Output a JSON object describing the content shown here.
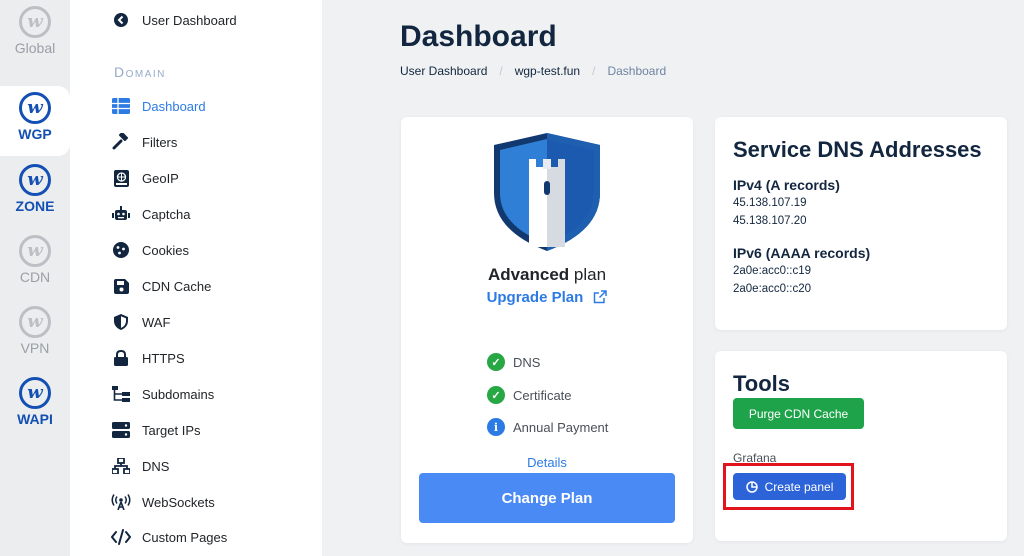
{
  "rail": [
    {
      "label": "Global",
      "logo": "w-logo"
    },
    {
      "label": "WGP",
      "logo": "w-logo"
    },
    {
      "label": "ZONE",
      "logo": "w-logo"
    },
    {
      "label": "CDN",
      "logo": "w-logo"
    },
    {
      "label": "VPN",
      "logo": "w-logo"
    },
    {
      "label": "WAPI",
      "logo": "w-logo"
    }
  ],
  "sidebar": {
    "back_label": "User Dashboard",
    "section_title": "Domain",
    "items": [
      {
        "label": "Dashboard",
        "icon": "table-icon"
      },
      {
        "label": "Filters",
        "icon": "gavel-icon"
      },
      {
        "label": "GeoIP",
        "icon": "atlas-icon"
      },
      {
        "label": "Captcha",
        "icon": "robot-icon"
      },
      {
        "label": "Cookies",
        "icon": "cookie-icon"
      },
      {
        "label": "CDN Cache",
        "icon": "save-icon"
      },
      {
        "label": "WAF",
        "icon": "shield-icon"
      },
      {
        "label": "HTTPS",
        "icon": "lock-icon"
      },
      {
        "label": "Subdomains",
        "icon": "sitemap-icon"
      },
      {
        "label": "Target IPs",
        "icon": "server-icon"
      },
      {
        "label": "DNS",
        "icon": "network-icon"
      },
      {
        "label": "WebSockets",
        "icon": "broadcast-icon"
      },
      {
        "label": "Custom Pages",
        "icon": "code-icon"
      }
    ]
  },
  "header": {
    "title": "Dashboard",
    "breadcrumb": [
      "User Dashboard",
      "wgp-test.fun",
      "Dashboard"
    ]
  },
  "plan": {
    "name_bold": "Advanced",
    "name_rest": " plan",
    "upgrade_label": "Upgrade Plan",
    "features": [
      {
        "label": "DNS",
        "status": "check"
      },
      {
        "label": "Certificate",
        "status": "check"
      },
      {
        "label": "Annual Payment",
        "status": "info"
      }
    ],
    "details_label": "Details",
    "change_label": "Change Plan"
  },
  "dns": {
    "title": "Service DNS Addresses",
    "ipv4_title": "IPv4 (A records)",
    "ipv4": [
      "45.138.107.19",
      "45.138.107.20"
    ],
    "ipv6_title": "IPv6 (AAAA records)",
    "ipv6": [
      "2a0e:acc0::c19",
      "2a0e:acc0::c20"
    ]
  },
  "tools": {
    "title": "Tools",
    "purge_label": "Purge CDN Cache",
    "grafana_label": "Grafana",
    "create_panel_label": "Create panel"
  },
  "colors": {
    "accent": "#2c7be5",
    "brand": "#1450b4",
    "success": "#1fa34a",
    "highlight": "#e1141e"
  }
}
